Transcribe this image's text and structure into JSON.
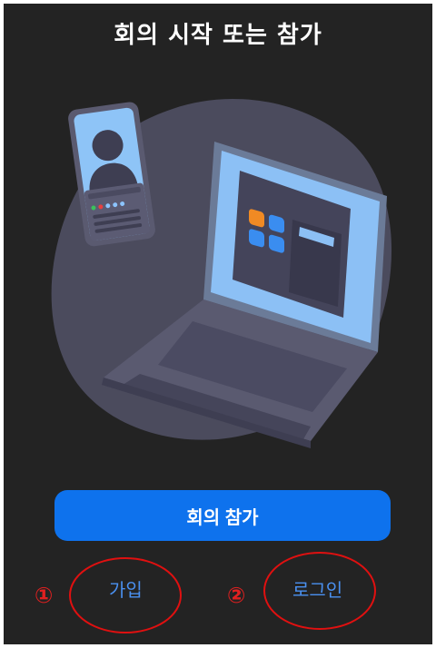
{
  "header": {
    "title": "회의 시작 또는 참가"
  },
  "actions": {
    "join_meeting_label": "회의 참가",
    "signup_label": "가입",
    "login_label": "로그인"
  },
  "annotations": {
    "marker_1": "①",
    "marker_2": "②"
  },
  "colors": {
    "background": "#232323",
    "primary_button": "#0e72ed",
    "link": "#4a90f0",
    "annotation": "#e01010"
  },
  "illustration": {
    "icon": "video-meeting-illustration",
    "app_tile_colors": [
      "#f08a24",
      "#3a8df0",
      "#3a8df0",
      "#3a8df0"
    ],
    "status_dot_colors": [
      "#3ac25c",
      "#e84040",
      "#8cc4ff",
      "#8cc4ff",
      "#8cc4ff"
    ]
  }
}
